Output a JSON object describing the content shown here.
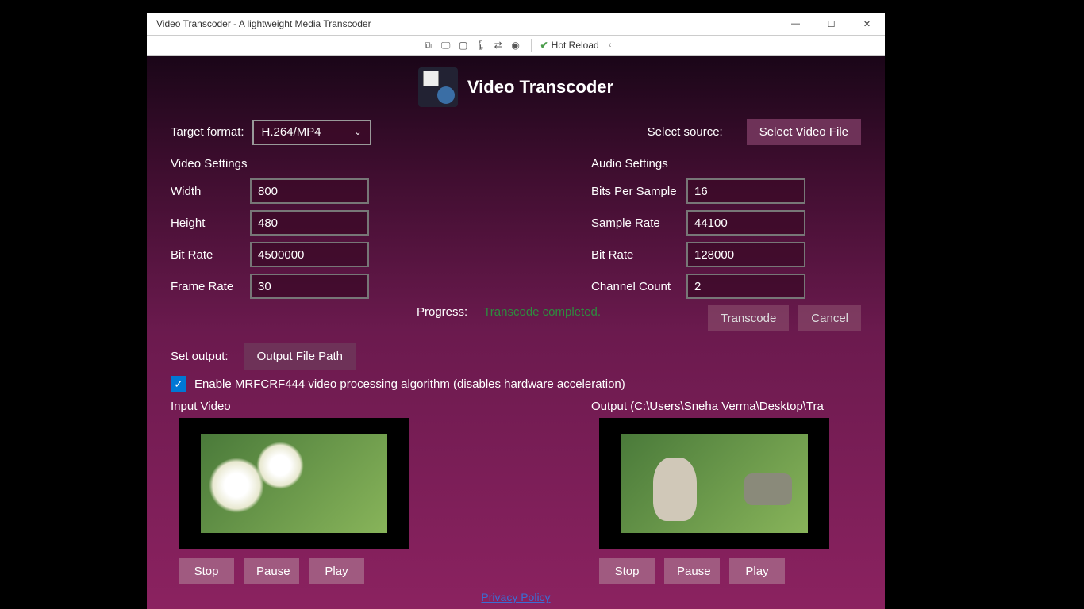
{
  "window": {
    "title": "Video Transcoder - A lightweight Media Transcoder"
  },
  "toolbar": {
    "hot_reload": "Hot Reload"
  },
  "header": {
    "title": "Video Transcoder"
  },
  "top": {
    "target_format_label": "Target format:",
    "target_format_value": "H.264/MP4",
    "select_source_label": "Select source:",
    "select_file_btn": "Select Video File"
  },
  "video_settings": {
    "title": "Video Settings",
    "width_label": "Width",
    "width_value": "800",
    "height_label": "Height",
    "height_value": "480",
    "bitrate_label": "Bit Rate",
    "bitrate_value": "4500000",
    "framerate_label": "Frame Rate",
    "framerate_value": "30"
  },
  "audio_settings": {
    "title": "Audio Settings",
    "bits_label": "Bits Per Sample",
    "bits_value": "16",
    "sample_label": "Sample Rate",
    "sample_value": "44100",
    "bitrate_label": "Bit Rate",
    "bitrate_value": "128000",
    "channel_label": "Channel Count",
    "channel_value": "2"
  },
  "progress": {
    "label": "Progress:",
    "status": "Transcode completed."
  },
  "output": {
    "label": "Set output:",
    "btn": "Output File Path"
  },
  "actions": {
    "transcode": "Transcode",
    "cancel": "Cancel"
  },
  "checkbox": {
    "label": "Enable MRFCRF444 video processing algorithm (disables hardware acceleration)"
  },
  "preview": {
    "input_label": "Input Video",
    "output_label": "Output (C:\\Users\\Sneha Verma\\Desktop\\Tra",
    "stop": "Stop",
    "pause": "Pause",
    "play": "Play"
  },
  "footer": {
    "privacy": "Privacy Policy"
  }
}
